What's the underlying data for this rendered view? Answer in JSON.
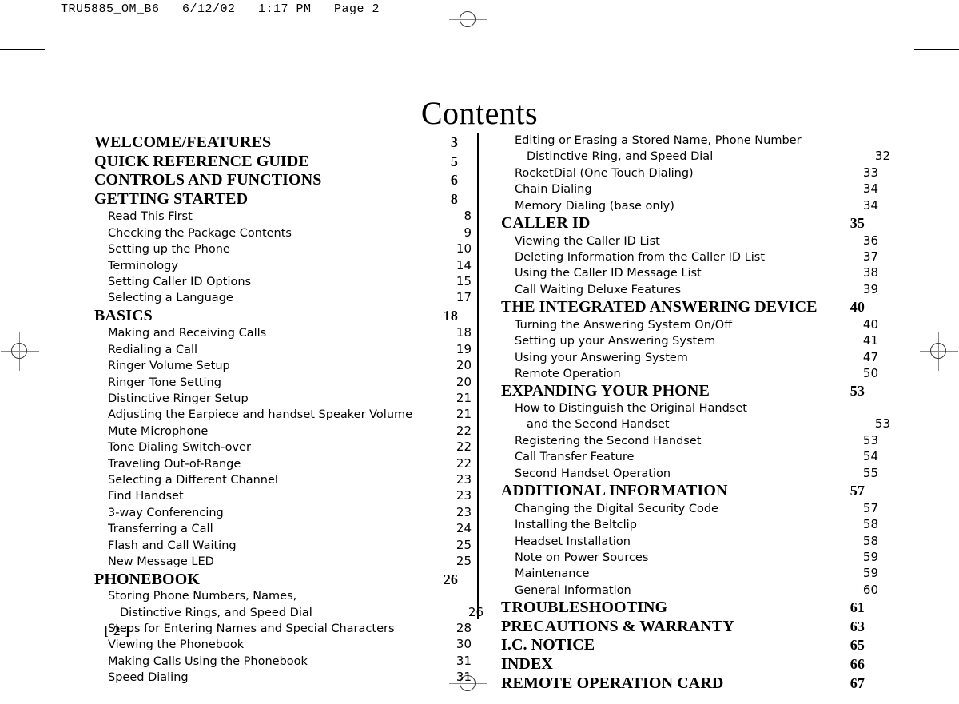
{
  "prepress": {
    "slug": "TRU5885_OM_B6   6/12/02   1:17 PM   Page 2"
  },
  "page": {
    "title": "Contents",
    "folio": "[ 2 ]"
  },
  "toc": {
    "left_column": [
      {
        "type": "heading",
        "label": "WELCOME/FEATURES",
        "page": "3"
      },
      {
        "type": "heading",
        "label": "QUICK REFERENCE GUIDE",
        "page": "5"
      },
      {
        "type": "heading",
        "label": "CONTROLS AND FUNCTIONS",
        "page": "6"
      },
      {
        "type": "heading",
        "label": "GETTING STARTED",
        "page": "8"
      },
      {
        "type": "entry",
        "label": "Read This First",
        "page": "8"
      },
      {
        "type": "entry",
        "label": "Checking the Package Contents",
        "page": "9"
      },
      {
        "type": "entry",
        "label": "Setting up the Phone",
        "page": "10"
      },
      {
        "type": "entry",
        "label": "Terminology",
        "page": "14"
      },
      {
        "type": "entry",
        "label": "Setting Caller ID Options",
        "page": "15"
      },
      {
        "type": "entry",
        "label": "Selecting a Language",
        "page": "17"
      },
      {
        "type": "heading",
        "label": "BASICS",
        "page": "18"
      },
      {
        "type": "entry",
        "label": "Making and Receiving Calls",
        "page": "18"
      },
      {
        "type": "entry",
        "label": "Redialing a Call",
        "page": "19"
      },
      {
        "type": "entry",
        "label": "Ringer Volume Setup",
        "page": "20"
      },
      {
        "type": "entry",
        "label": "Ringer Tone Setting",
        "page": "20"
      },
      {
        "type": "entry",
        "label": "Distinctive Ringer Setup",
        "page": "21"
      },
      {
        "type": "entry",
        "label": "Adjusting the Earpiece and handset Speaker Volume",
        "page": "21"
      },
      {
        "type": "entry",
        "label": "Mute Microphone",
        "page": "22"
      },
      {
        "type": "entry",
        "label": "Tone Dialing Switch-over",
        "page": "22"
      },
      {
        "type": "entry",
        "label": "Traveling Out-of-Range",
        "page": "22"
      },
      {
        "type": "entry",
        "label": "Selecting a Different Channel",
        "page": "23"
      },
      {
        "type": "entry",
        "label": "Find Handset",
        "page": "23"
      },
      {
        "type": "entry",
        "label": "3-way Conferencing",
        "page": "23"
      },
      {
        "type": "entry",
        "label": "Transferring a Call",
        "page": "24"
      },
      {
        "type": "entry",
        "label": "Flash and Call Waiting",
        "page": "25"
      },
      {
        "type": "entry",
        "label": "New Message LED",
        "page": "25"
      },
      {
        "type": "heading",
        "label": "PHONEBOOK",
        "page": "26"
      },
      {
        "type": "entry",
        "label": "Storing Phone Numbers, Names,",
        "page": ""
      },
      {
        "type": "entry-cont",
        "label": "Distinctive Rings, and Speed Dial",
        "page": "26"
      },
      {
        "type": "entry",
        "label": "Steps for Entering Names and Special Characters",
        "page": "28"
      },
      {
        "type": "entry",
        "label": "Viewing the Phonebook",
        "page": "30"
      },
      {
        "type": "entry",
        "label": "Making Calls Using the Phonebook",
        "page": "31"
      },
      {
        "type": "entry",
        "label": "Speed Dialing",
        "page": "31"
      }
    ],
    "right_column": [
      {
        "type": "entry",
        "label": "Editing or Erasing a Stored Name, Phone Number",
        "page": ""
      },
      {
        "type": "entry-cont",
        "label": "Distinctive Ring, and Speed Dial",
        "page": "32"
      },
      {
        "type": "entry",
        "label": "RocketDial (One Touch Dialing)",
        "page": "33"
      },
      {
        "type": "entry",
        "label": "Chain Dialing",
        "page": "34"
      },
      {
        "type": "entry",
        "label": "Memory Dialing (base only)",
        "page": "34"
      },
      {
        "type": "heading",
        "label": "CALLER ID",
        "page": "35"
      },
      {
        "type": "entry",
        "label": "Viewing the Caller ID List",
        "page": "36"
      },
      {
        "type": "entry",
        "label": "Deleting Information from the Caller ID List",
        "page": "37"
      },
      {
        "type": "entry",
        "label": "Using the Caller ID Message List",
        "page": "38"
      },
      {
        "type": "entry",
        "label": "Call Waiting Deluxe Features",
        "page": "39"
      },
      {
        "type": "heading",
        "label": "THE INTEGRATED ANSWERING DEVICE",
        "page": "40"
      },
      {
        "type": "entry",
        "label": "Turning the Answering System On/Off",
        "page": "40"
      },
      {
        "type": "entry",
        "label": "Setting up your Answering System",
        "page": "41"
      },
      {
        "type": "entry",
        "label": "Using your Answering System",
        "page": "47"
      },
      {
        "type": "entry",
        "label": "Remote Operation",
        "page": "50"
      },
      {
        "type": "heading",
        "label": "EXPANDING YOUR PHONE",
        "page": "53"
      },
      {
        "type": "entry",
        "label": "How to Distinguish the Original Handset",
        "page": ""
      },
      {
        "type": "entry-cont",
        "label": "and the Second Handset",
        "page": "53"
      },
      {
        "type": "entry",
        "label": "Registering the Second Handset",
        "page": "53"
      },
      {
        "type": "entry",
        "label": "Call Transfer Feature",
        "page": "54"
      },
      {
        "type": "entry",
        "label": "Second Handset Operation",
        "page": "55"
      },
      {
        "type": "heading",
        "label": "ADDITIONAL INFORMATION",
        "page": "57"
      },
      {
        "type": "entry",
        "label": "Changing the Digital Security Code",
        "page": "57"
      },
      {
        "type": "entry",
        "label": "Installing the Beltclip",
        "page": "58"
      },
      {
        "type": "entry",
        "label": "Headset Installation",
        "page": "58"
      },
      {
        "type": "entry",
        "label": "Note on Power Sources",
        "page": "59"
      },
      {
        "type": "entry",
        "label": "Maintenance",
        "page": "59"
      },
      {
        "type": "entry",
        "label": "General Information",
        "page": "60"
      },
      {
        "type": "heading",
        "label": "TROUBLESHOOTING",
        "page": "61"
      },
      {
        "type": "heading",
        "label": "PRECAUTIONS & WARRANTY",
        "page": "63"
      },
      {
        "type": "heading",
        "label": "I.C. NOTICE",
        "page": "65"
      },
      {
        "type": "heading",
        "label": "INDEX",
        "page": "66"
      },
      {
        "type": "heading",
        "label": "REMOTE OPERATION CARD",
        "page": "67"
      }
    ]
  }
}
